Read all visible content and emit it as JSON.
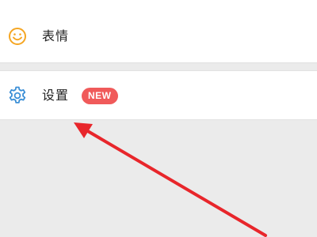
{
  "menu": {
    "items": [
      {
        "label": "表情",
        "icon": "smiley-icon",
        "icon_color": "#f5a623"
      },
      {
        "label": "设置",
        "icon": "gear-icon",
        "icon_color": "#3b8fd6",
        "badge": "NEW",
        "badge_color": "#f05a5a"
      }
    ]
  },
  "colors": {
    "panel_background": "#ebebeb",
    "row_background": "#ffffff",
    "annotation_arrow": "#e8262b"
  }
}
